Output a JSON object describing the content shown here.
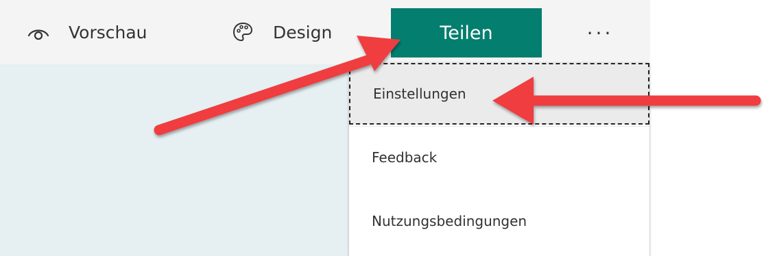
{
  "toolbar": {
    "preview_label": "Vorschau",
    "preview_icon": "eye-icon",
    "design_label": "Design",
    "design_icon": "palette-icon",
    "share_label": "Teilen",
    "more_label": "···",
    "more_icon": "more-dots-icon"
  },
  "menu": {
    "items": [
      {
        "label": "Einstellungen"
      },
      {
        "label": "Feedback"
      },
      {
        "label": "Nutzungsbedingungen"
      }
    ]
  },
  "colors": {
    "share_button": "#047e6e",
    "toolbar_bg": "#f4f4f4",
    "content_bg": "#e6eff2",
    "annotation_arrow": "#ef3c3f"
  }
}
